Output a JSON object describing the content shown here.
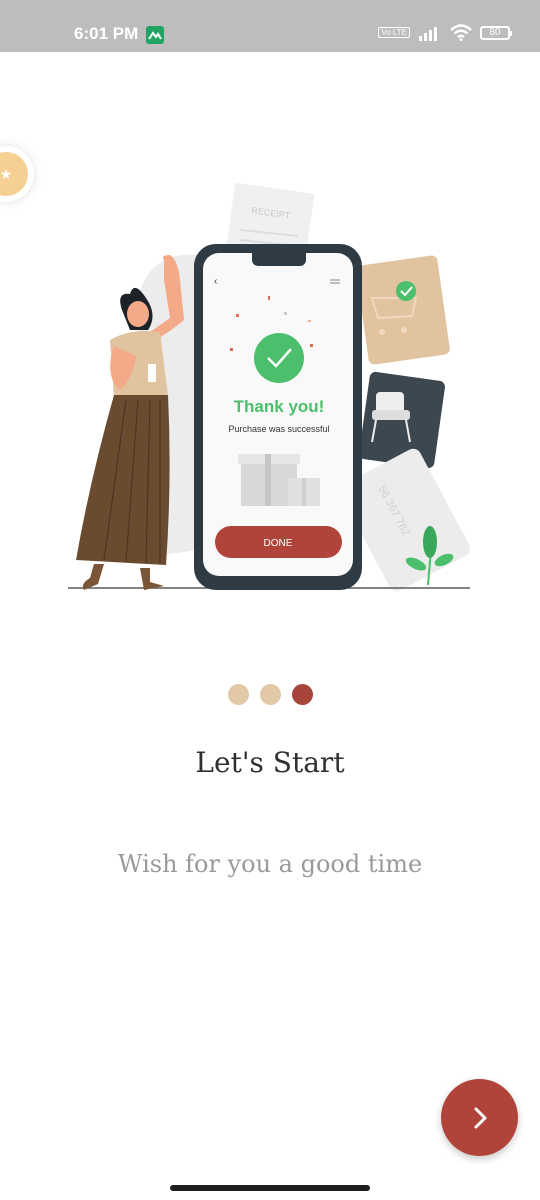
{
  "status_bar": {
    "time": "6:01 PM",
    "network_badge": "Vo LTE",
    "battery_level": "80",
    "icons": [
      "app-notification-icon",
      "signal-icon",
      "wifi-icon",
      "battery-icon"
    ]
  },
  "floating_bubble": {
    "icon": "star-icon"
  },
  "illustration": {
    "receipt_label": "RECEIPT",
    "thank_you": "Thank you!",
    "purchase_message": "Purchase was successful",
    "done_button": "DONE",
    "card_number": "56 367 782"
  },
  "onboarding": {
    "page_count": 3,
    "active_page": 3,
    "title": "Let's Start",
    "subtitle": "Wish for you a good time"
  },
  "next_button": {
    "icon": "chevron-right-icon"
  },
  "colors": {
    "accent": "#b1443a",
    "dot_inactive": "#e2c8a6",
    "success_green": "#4bbf6b",
    "status_bar": "#bdbdbd"
  }
}
